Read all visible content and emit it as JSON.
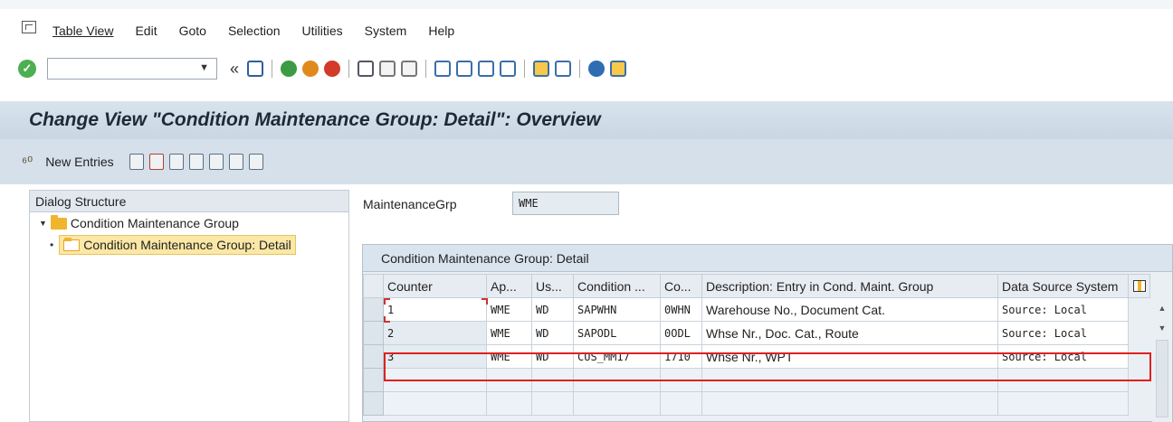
{
  "menu": {
    "items": [
      "Table View",
      "Edit",
      "Goto",
      "Selection",
      "Utilities",
      "System",
      "Help"
    ]
  },
  "toolbar": {
    "command_value": "",
    "back_arrows": "«"
  },
  "title": "Change View \"Condition Maintenance Group: Detail\": Overview",
  "app_toolbar": {
    "new_entries_label": "New Entries"
  },
  "dialog_structure": {
    "header": "Dialog Structure",
    "items": [
      {
        "label": "Condition Maintenance Group"
      },
      {
        "label": "Condition Maintenance Group: Detail"
      }
    ]
  },
  "maintenance_group": {
    "label": "MaintenanceGrp",
    "value": "WME"
  },
  "table": {
    "title": "Condition Maintenance Group: Detail",
    "columns": [
      "Counter",
      "Ap...",
      "Us...",
      "Condition ...",
      "Co...",
      "Description: Entry in Cond. Maint. Group",
      "Data Source System"
    ],
    "rows": [
      [
        "1",
        "WME",
        "WD",
        "SAPWHN",
        "0WHN",
        "Warehouse No., Document Cat.",
        "Source: Local"
      ],
      [
        "2",
        "WME",
        "WD",
        "SAPODL",
        "0ODL",
        "Whse Nr., Doc. Cat., Route",
        "Source: Local"
      ],
      [
        "3",
        "WME",
        "WD",
        "CUS_MM17",
        "1710",
        "Whse Nr., WPT",
        "Source: Local"
      ]
    ]
  },
  "colors": {
    "title_bar": "#c9d7e3",
    "highlight": "#e02020",
    "folder": "#f0b42d",
    "ok_green": "#4caf50"
  }
}
